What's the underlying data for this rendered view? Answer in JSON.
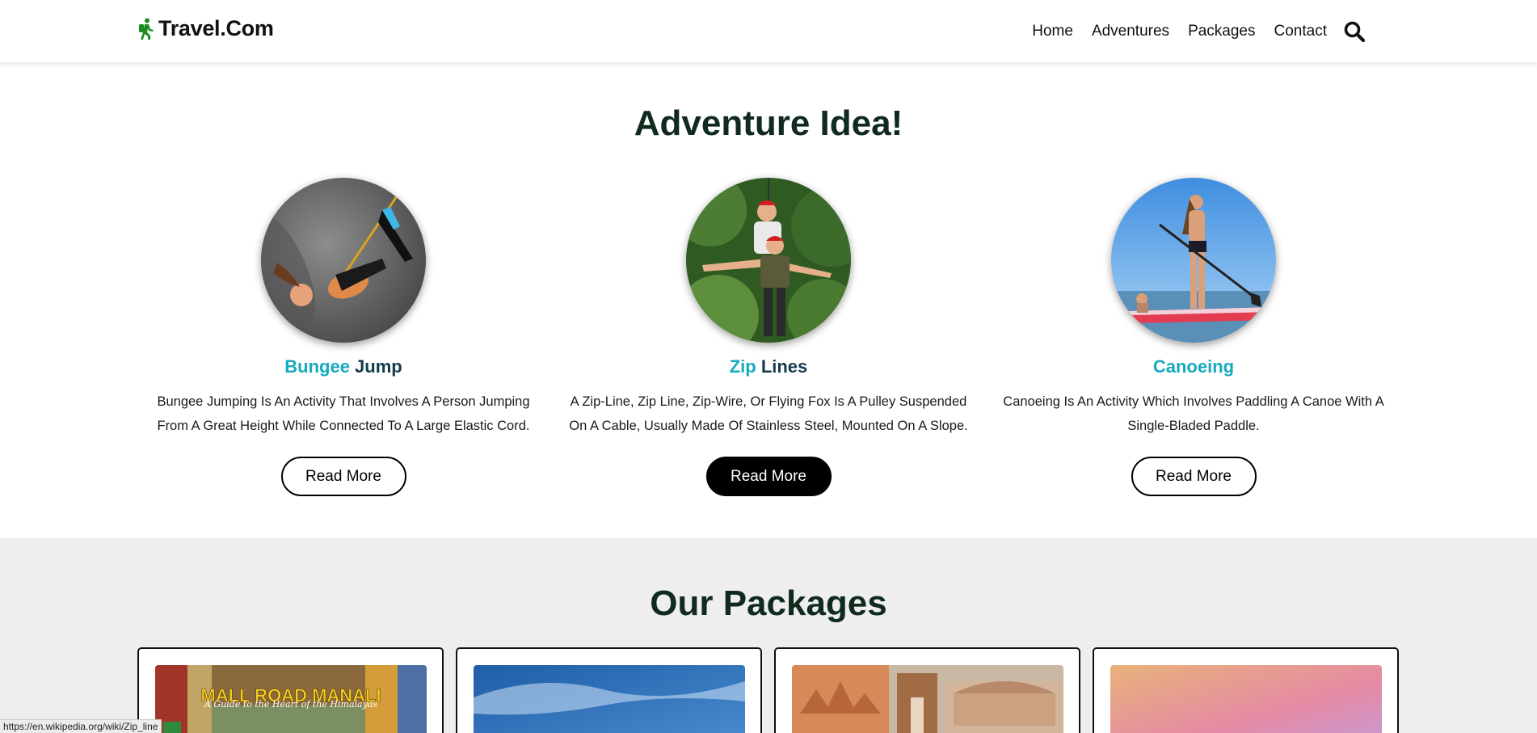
{
  "header": {
    "logo_text": "Travel.Com",
    "logo_icon": "hiker-icon",
    "nav": [
      "Home",
      "Adventures",
      "Packages",
      "Contact"
    ],
    "search_icon": "search-icon"
  },
  "adventures": {
    "title": "Adventure Idea!",
    "cards": [
      {
        "title_accent": "Bungee",
        "title_rest": " Jump",
        "description": "Bungee Jumping Is An Activity That Involves A Person Jumping From A Great Height While Connected To A Large Elastic Cord.",
        "button": "Read More"
      },
      {
        "title_accent": "Zip",
        "title_rest": " Lines",
        "description": "A Zip-Line, Zip Line, Zip-Wire, Or Flying Fox Is A Pulley Suspended On A Cable, Usually Made Of Stainless Steel, Mounted On A Slope.",
        "button": "Read More"
      },
      {
        "title_accent": "Canoeing",
        "title_rest": "",
        "description": "Canoeing Is An Activity Which Involves Paddling A Canoe With A Single-Bladed Paddle.",
        "button": "Read More"
      }
    ]
  },
  "packages": {
    "title": "Our Packages",
    "cards": [
      {
        "image_heading": "MALL ROAD MANALI",
        "image_subheading": "A Guide to the Heart of the Himalayas"
      },
      {},
      {},
      {}
    ]
  },
  "status_bar": {
    "url": "https://en.wikipedia.org/wiki/Zip_line"
  },
  "colors": {
    "accent": "#17a9bf",
    "title_dark": "#102a1e",
    "logo_green": "#1d8a22",
    "section_gray": "#eeeeee"
  }
}
